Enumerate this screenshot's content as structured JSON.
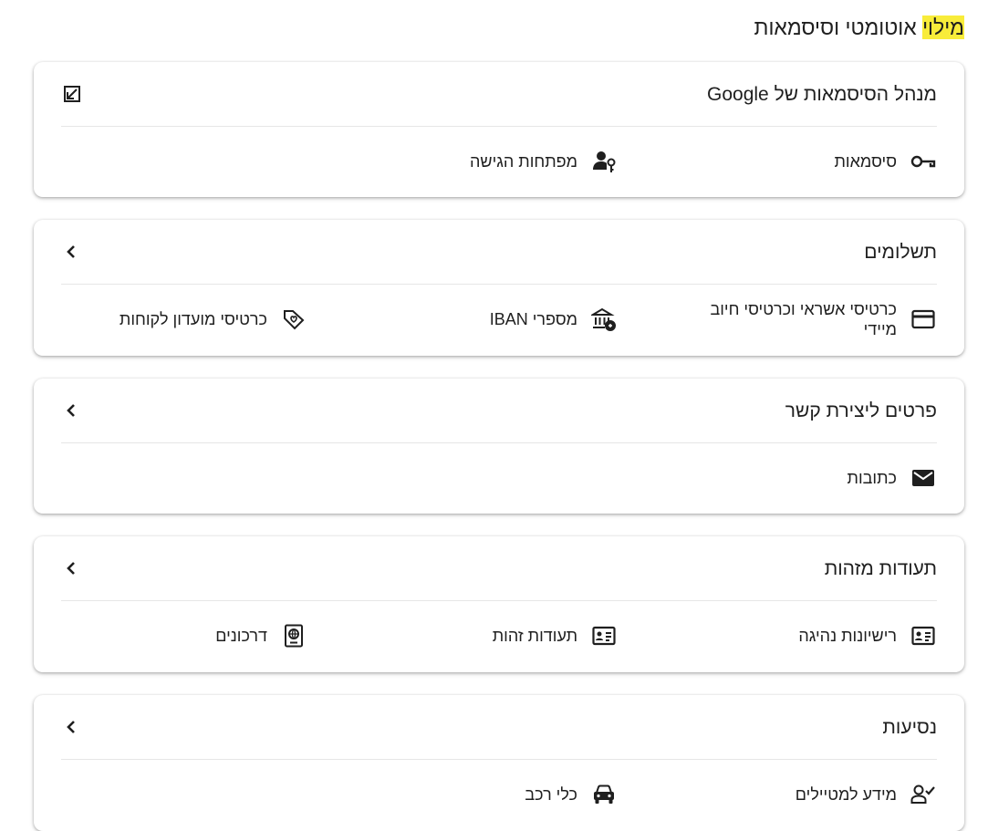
{
  "page": {
    "title_highlight": "מילוי",
    "title_rest": " אוטומטי וסיסמאות",
    "highlight_color": "#f8ec3a"
  },
  "cards": {
    "passwords": {
      "title": "מנהל הסיסמאות של Google",
      "header_icon": "open-in-new-icon",
      "items": [
        {
          "label": "סיסמאות",
          "icon": "key-icon"
        },
        {
          "label": "מפתחות הגישה",
          "icon": "person-key-icon"
        }
      ]
    },
    "payments": {
      "title": "תשלומים",
      "header_icon": "chevron-icon",
      "items": [
        {
          "label": "כרטיסי אשראי וכרטיסי חיוב מיידי",
          "icon": "credit-card-icon"
        },
        {
          "label": "מספרי IBAN",
          "icon": "bank-icon"
        },
        {
          "label": "כרטיסי מועדון לקוחות",
          "icon": "loyalty-tag-icon"
        }
      ]
    },
    "contact": {
      "title": "פרטים ליצירת קשר",
      "header_icon": "chevron-icon",
      "items": [
        {
          "label": "כתובות",
          "icon": "mail-icon"
        }
      ]
    },
    "ids": {
      "title": "תעודות מזהות",
      "header_icon": "chevron-icon",
      "items": [
        {
          "label": "רישיונות נהיגה",
          "icon": "id-card-icon"
        },
        {
          "label": "תעודות זהות",
          "icon": "id-card-icon"
        },
        {
          "label": "דרכונים",
          "icon": "passport-icon"
        }
      ]
    },
    "travel": {
      "title": "נסיעות",
      "header_icon": "chevron-icon",
      "items": [
        {
          "label": "מידע למטיילים",
          "icon": "person-check-icon"
        },
        {
          "label": "כלי רכב",
          "icon": "car-icon"
        }
      ]
    }
  }
}
